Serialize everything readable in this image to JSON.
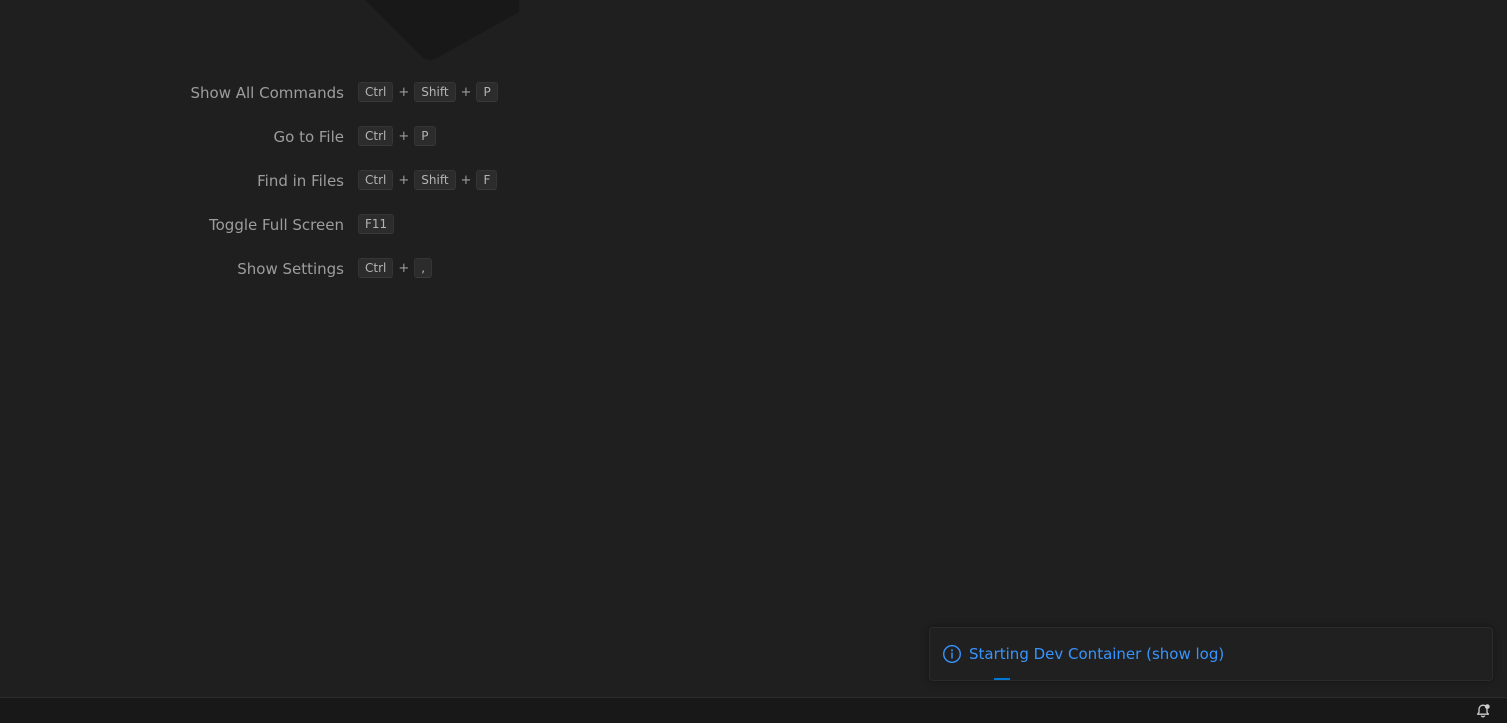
{
  "welcome": {
    "shortcuts": [
      {
        "label": "Show All Commands",
        "keys": [
          "Ctrl",
          "Shift",
          "P"
        ]
      },
      {
        "label": "Go to File",
        "keys": [
          "Ctrl",
          "P"
        ]
      },
      {
        "label": "Find in Files",
        "keys": [
          "Ctrl",
          "Shift",
          "F"
        ]
      },
      {
        "label": "Toggle Full Screen",
        "keys": [
          "F11"
        ]
      },
      {
        "label": "Show Settings",
        "keys": [
          "Ctrl",
          ","
        ]
      }
    ],
    "key_separator": "+"
  },
  "notification": {
    "icon": "info-icon",
    "message": "Starting Dev Container (show log)",
    "link_color": "#3794ff",
    "progress_color": "#0078d4"
  },
  "statusbar": {
    "icon": "bell-dot-icon"
  },
  "colors": {
    "editor_background": "#1f1f1f",
    "statusbar_background": "#181818"
  }
}
